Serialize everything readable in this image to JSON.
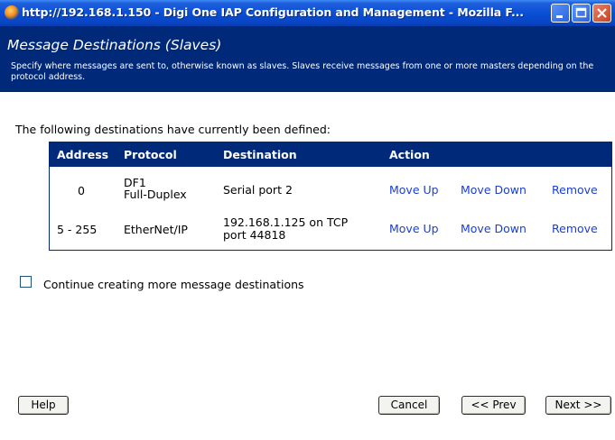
{
  "window": {
    "title": "http://192.168.1.150 - Digi One IAP Configuration and Management - Mozilla F..."
  },
  "header": {
    "title": "Message Destinations (Slaves)",
    "description": "Specify where messages are sent to, otherwise known as slaves. Slaves receive messages from one or more masters depending on the protocol address."
  },
  "intro": "The following destinations have currently been defined:",
  "table": {
    "columns": [
      "Address",
      "Protocol",
      "Destination",
      "Action"
    ],
    "rows": [
      {
        "address": "0",
        "protocol_line1": "DF1",
        "protocol_line2": "Full-Duplex",
        "destination_line1": "Serial port 2",
        "destination_line2": "",
        "move_up": "Move Up",
        "move_down": "Move Down",
        "remove": "Remove"
      },
      {
        "address": "5 - 255",
        "protocol_line1": "EtherNet/IP",
        "protocol_line2": "",
        "destination_line1": "192.168.1.125 on TCP",
        "destination_line2": "port 44818",
        "move_up": "Move Up",
        "move_down": "Move Down",
        "remove": "Remove"
      }
    ]
  },
  "continue_checkbox": {
    "label": "Continue creating more message destinations",
    "checked": false
  },
  "buttons": {
    "help": "Help",
    "cancel": "Cancel",
    "prev": "<< Prev",
    "next": "Next >>"
  },
  "colors": {
    "header_bg": "#00297a",
    "link": "#1a3ed0"
  }
}
